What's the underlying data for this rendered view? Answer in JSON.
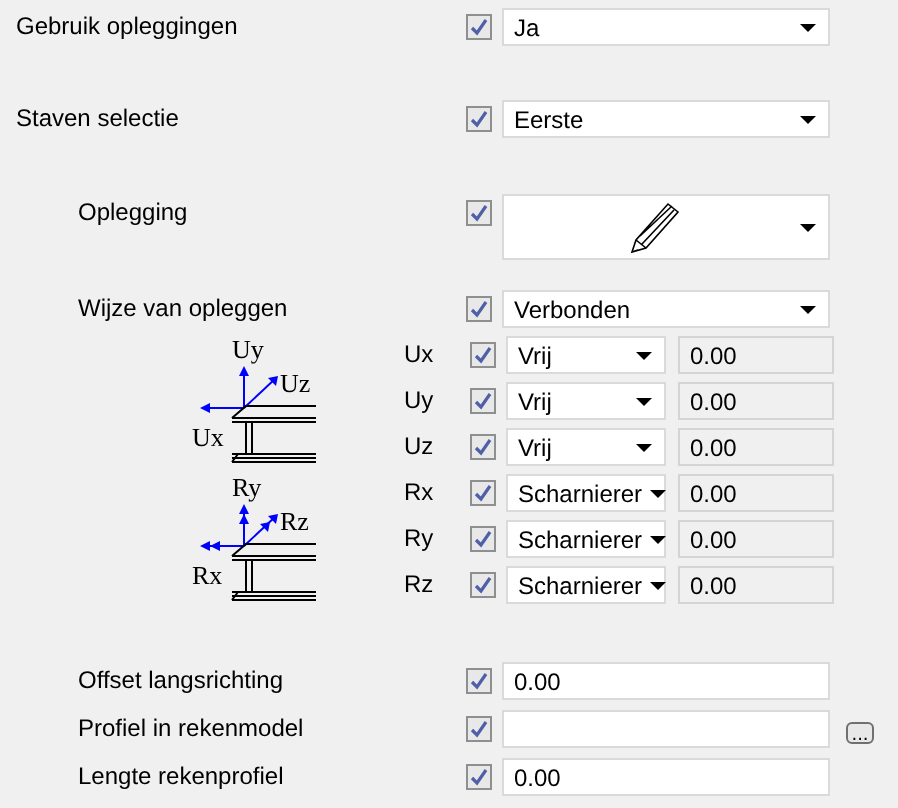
{
  "properties": [
    {
      "kind": "dropdown",
      "label": "Gebruik opleggingen",
      "checked": true,
      "value": "Ja"
    },
    {
      "kind": "dropdown",
      "label": "Staven selectie",
      "checked": true,
      "value": "Eerste",
      "children": [
        {
          "kind": "icon-dropdown",
          "label": "Oplegging",
          "checked": true
        },
        {
          "kind": "dropdown",
          "label": "Wijze van opleggen",
          "checked": true,
          "value": "Verbonden"
        },
        {
          "kind": "translation-group",
          "diagram_labels": {
            "vertical": "Uy",
            "diagonal": "Uz",
            "horizontal": "Ux"
          },
          "rows": [
            {
              "label": "Ux",
              "checked": true,
              "value": "Vrij",
              "amount": "0.00"
            },
            {
              "label": "Uy",
              "checked": true,
              "value": "Vrij",
              "amount": "0.00"
            },
            {
              "label": "Uz",
              "checked": true,
              "value": "Vrij",
              "amount": "0.00"
            }
          ]
        },
        {
          "kind": "rotation-group",
          "diagram_labels": {
            "vertical": "Ry",
            "diagonal": "Rz",
            "horizontal": "Rx"
          },
          "rows": [
            {
              "label": "Rx",
              "checked": true,
              "value": "Scharnierer",
              "amount": "0.00"
            },
            {
              "label": "Ry",
              "checked": true,
              "value": "Scharnierer",
              "amount": "0.00"
            },
            {
              "label": "Rz",
              "checked": true,
              "value": "Scharnierer",
              "amount": "0.00"
            }
          ]
        },
        {
          "kind": "text",
          "label": "Offset langsrichting",
          "checked": true,
          "value": "0.00"
        },
        {
          "kind": "text-browse",
          "label": "Profiel in rekenmodel",
          "checked": true,
          "browse_label": "..."
        },
        {
          "kind": "text",
          "label": "Lengte rekenprofiel",
          "checked": true,
          "value": "0.00"
        }
      ]
    }
  ]
}
